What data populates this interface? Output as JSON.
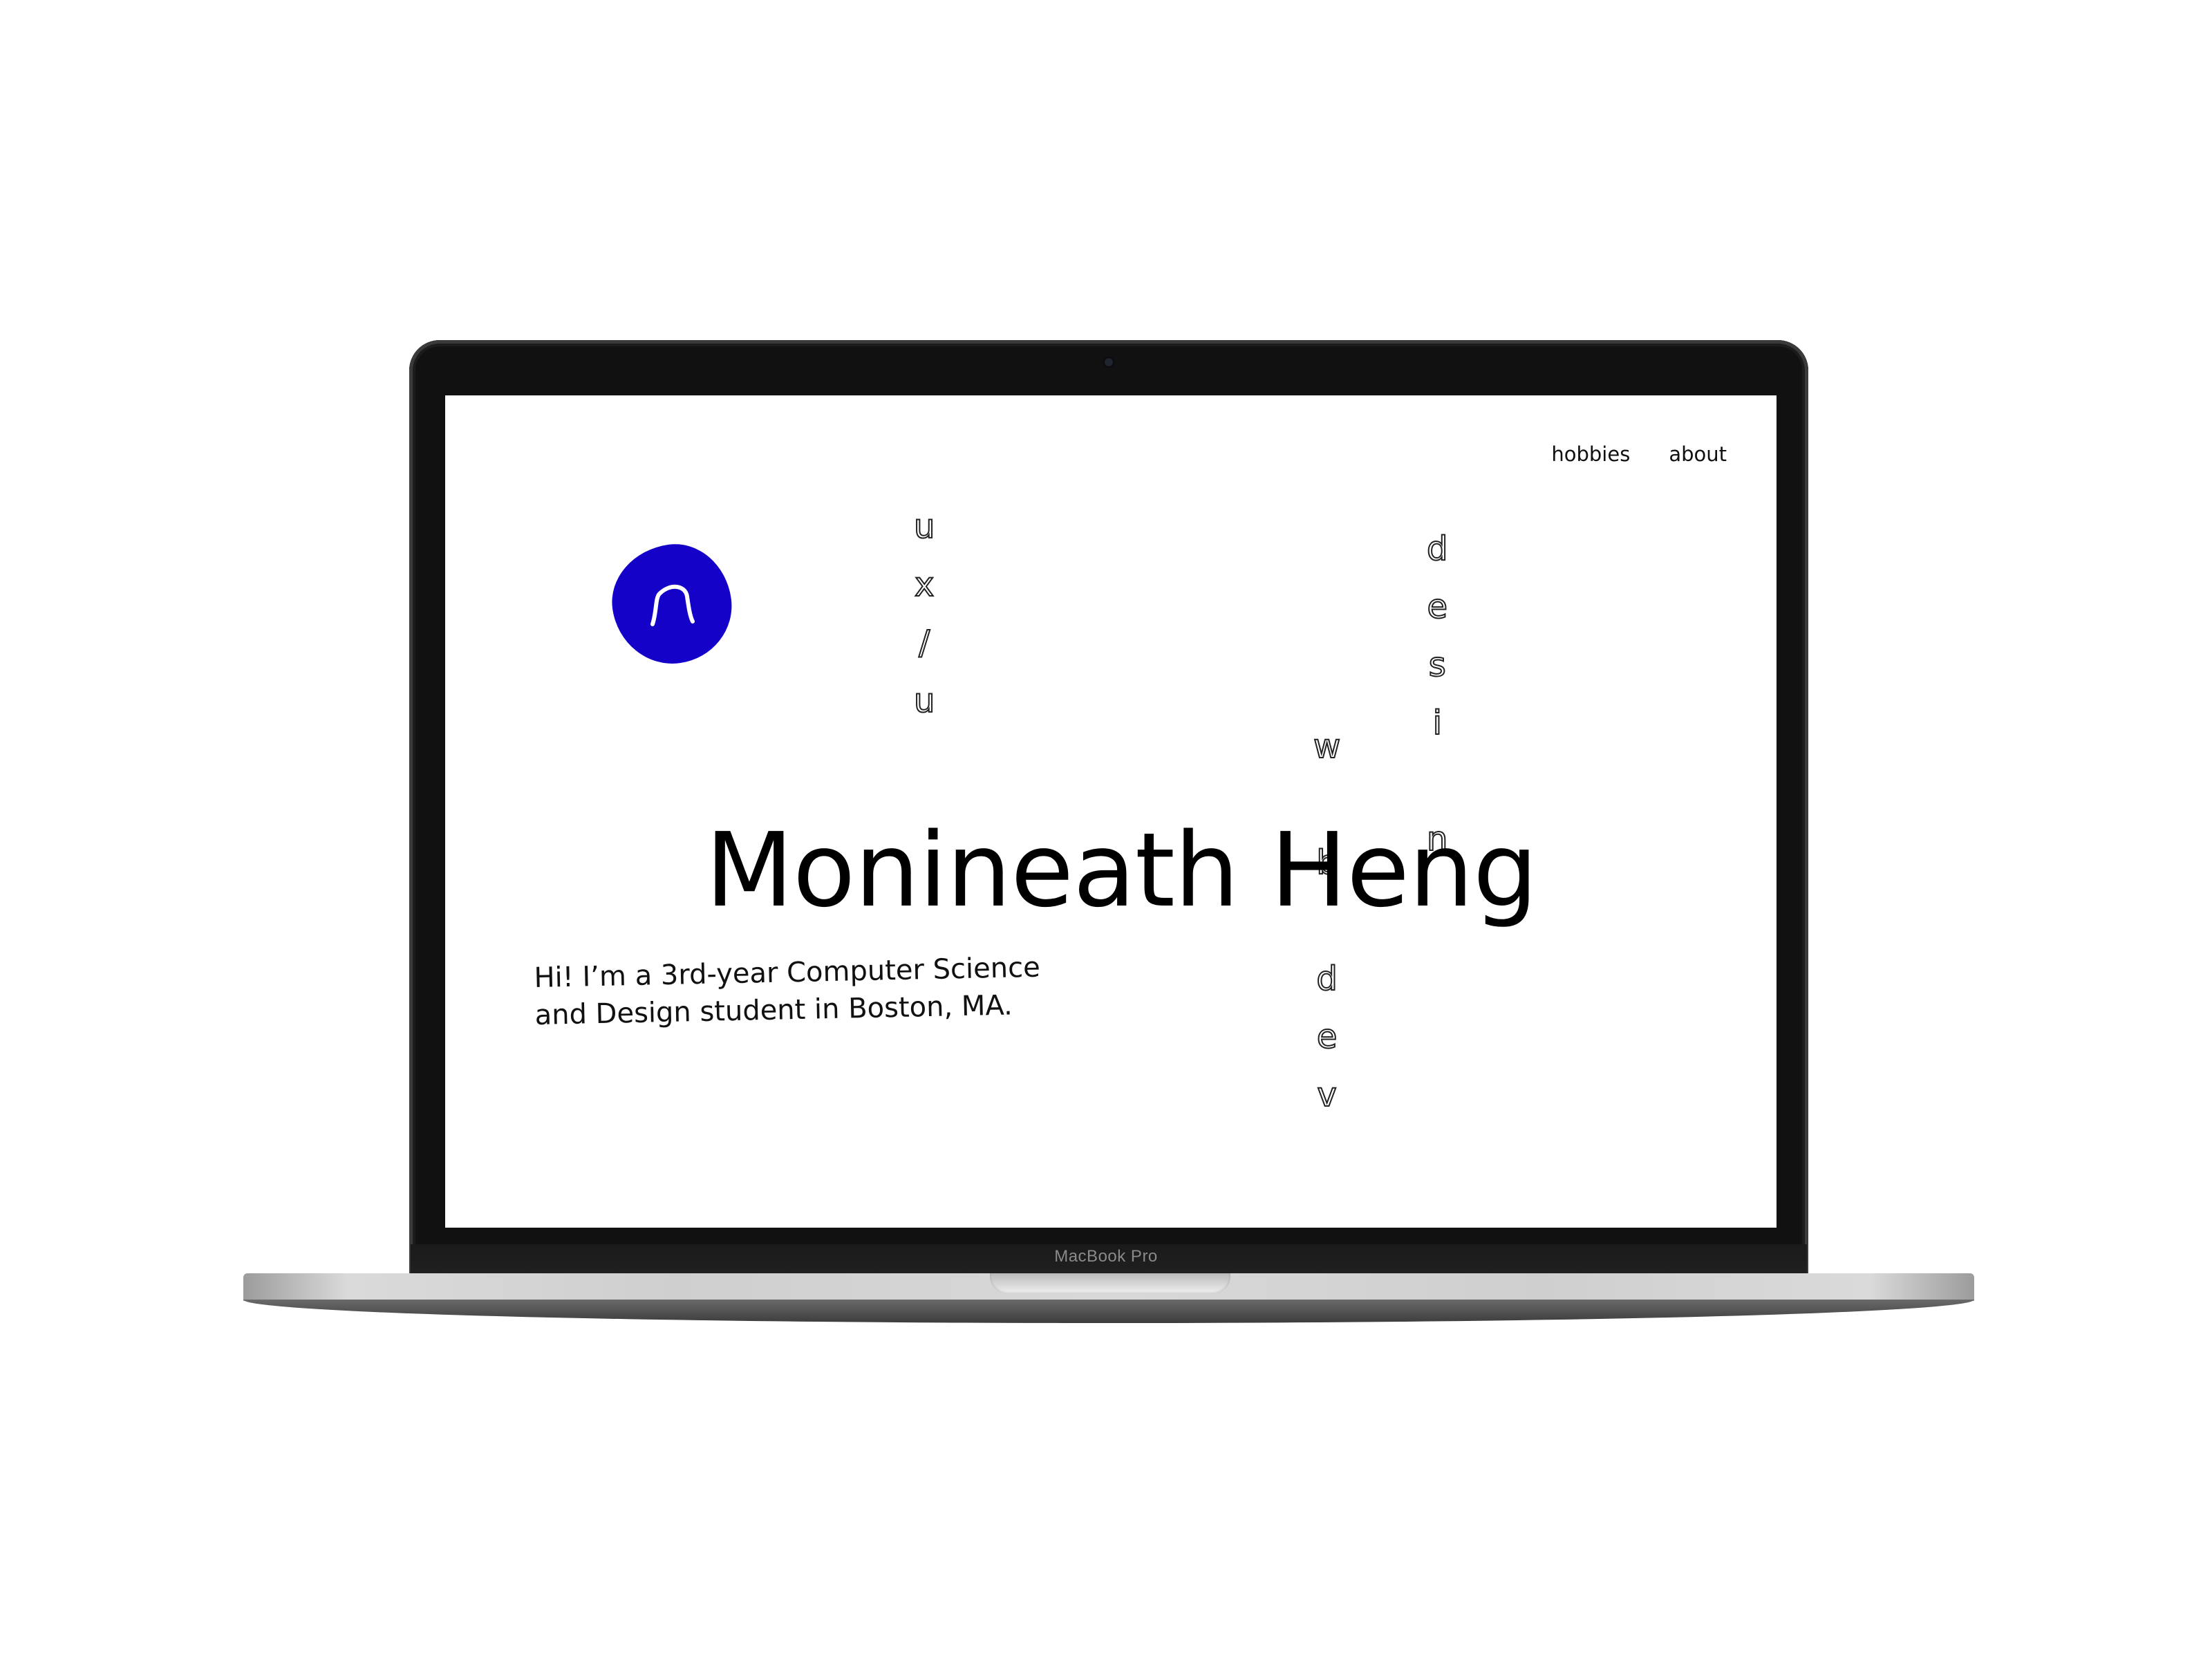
{
  "device": {
    "label": "MacBook Pro"
  },
  "nav": {
    "items": [
      {
        "label": "hobbies"
      },
      {
        "label": "about"
      }
    ]
  },
  "logo": {
    "letter": "n",
    "color": "#1402c9"
  },
  "vertical_words": {
    "uxui": [
      "u",
      "x",
      "/",
      "u"
    ],
    "design": [
      "d",
      "e",
      "s",
      "i",
      "n"
    ],
    "web_dev": [
      "w",
      "b",
      "d",
      "e",
      "v"
    ]
  },
  "hero": {
    "name": "Monineath Heng",
    "intro_line1": "Hi! I’m a 3rd-year Computer Science",
    "intro_line2": "and Design student in Boston, MA."
  }
}
